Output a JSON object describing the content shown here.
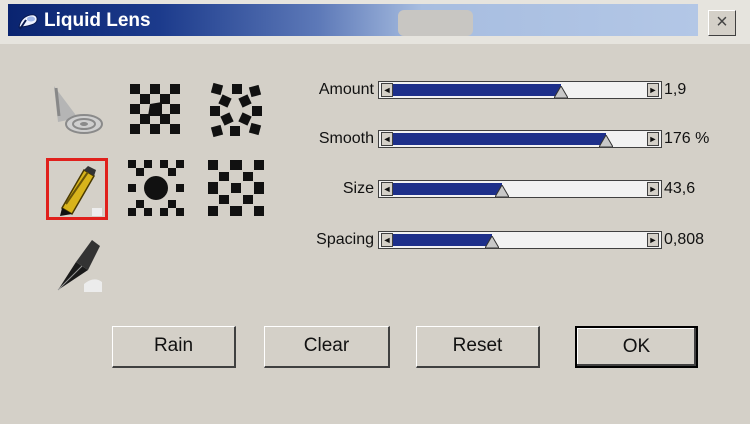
{
  "window": {
    "title": "Liquid Lens",
    "close_glyph": "×",
    "app_icon": "liquid-lens-icon"
  },
  "tools": [
    {
      "name": "swirl-tool",
      "icon": "water-swirl-icon",
      "selected": false
    },
    {
      "name": "pencil-tool",
      "icon": "pencil-icon",
      "selected": true
    },
    {
      "name": "pen-tool",
      "icon": "pen-nib-icon",
      "selected": false
    }
  ],
  "patterns": [
    {
      "name": "pattern-pinwheel",
      "icon": "checker-pinwheel-icon"
    },
    {
      "name": "pattern-twirl",
      "icon": "checker-twirl-icon"
    },
    {
      "name": "pattern-bulge",
      "icon": "checker-bulge-icon"
    },
    {
      "name": "pattern-pinch",
      "icon": "checker-pinch-icon"
    }
  ],
  "sliders": [
    {
      "label": "Amount",
      "value": "1,9",
      "level": 0.66
    },
    {
      "label": "Smooth",
      "value": "176 %",
      "level": 0.84
    },
    {
      "label": "Size",
      "value": "43,6",
      "level": 0.43
    },
    {
      "label": "Spacing",
      "value": "0,808",
      "level": 0.39
    }
  ],
  "buttons": {
    "rain": "Rain",
    "clear": "Clear",
    "reset": "Reset",
    "ok": "OK"
  },
  "colors": {
    "accent": "#1d2f8a",
    "title_dark": "#0a2470",
    "selected_outline": "#e0201c"
  }
}
